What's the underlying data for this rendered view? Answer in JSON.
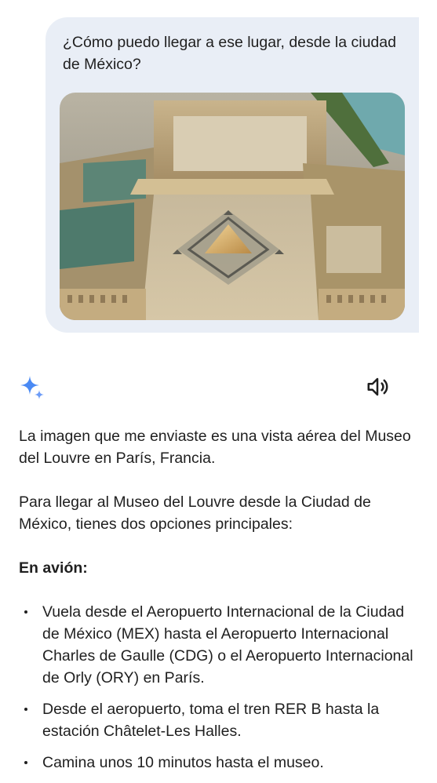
{
  "user_message": {
    "text": "¿Cómo puedo llegar a ese lugar, desde la ciudad de México?",
    "attachment_icon": "louvre-aerial-photo"
  },
  "assistant": {
    "logo_icon": "gemini-sparkle-icon",
    "read_aloud_icon": "speaker-icon",
    "paragraphs": [
      "La imagen que me enviaste es una vista aérea del Museo del Louvre en París, Francia.",
      "Para llegar al Museo del Louvre desde la Ciudad de México, tienes dos opciones principales:"
    ],
    "section_heading": "En avión:",
    "bullets": [
      "Vuela desde el Aeropuerto Internacional de la Ciudad de México (MEX) hasta el Aeropuerto Internacional Charles de Gaulle (CDG) o el Aeropuerto Internacional de Orly (ORY) en París.",
      "Desde el aeropuerto, toma el tren RER B hasta la estación Châtelet-Les Halles.",
      "Camina unos 10 minutos hasta el museo."
    ]
  },
  "colors": {
    "bubble": "#e9eef6",
    "text": "#1f1f1f",
    "sparkle_blue": "#4a8af4"
  }
}
